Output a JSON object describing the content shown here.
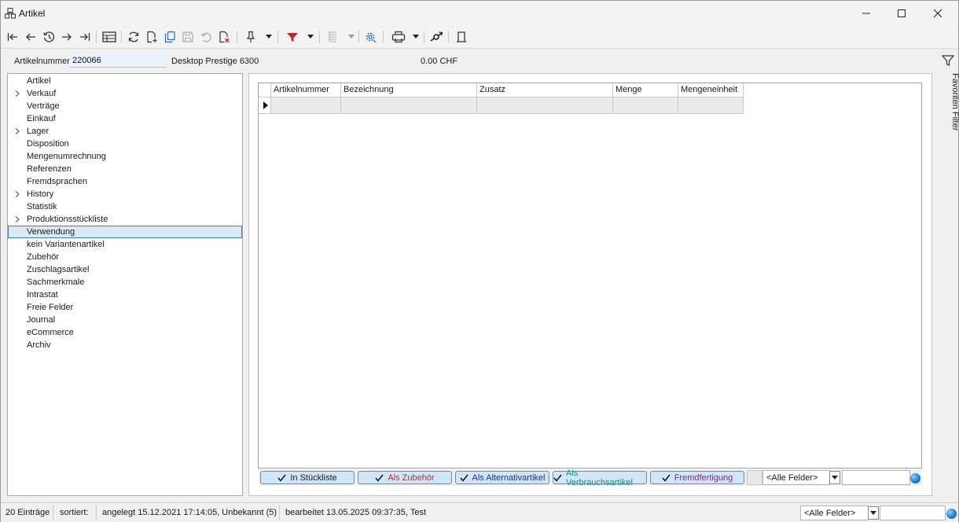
{
  "window": {
    "title": "Artikel"
  },
  "header": {
    "article_number_label": "Artikelnummer",
    "article_number_value": "220066",
    "article_name": "Desktop Prestige 6300",
    "price": "0.00",
    "currency": "CHF"
  },
  "tree": {
    "items": [
      {
        "label": "Artikel",
        "expandable": false
      },
      {
        "label": "Verkauf",
        "expandable": true
      },
      {
        "label": "Verträge",
        "expandable": false
      },
      {
        "label": "Einkauf",
        "expandable": false
      },
      {
        "label": "Lager",
        "expandable": true
      },
      {
        "label": "Disposition",
        "expandable": false
      },
      {
        "label": "Mengenumrechnung",
        "expandable": false
      },
      {
        "label": "Referenzen",
        "expandable": false
      },
      {
        "label": "Fremdsprachen",
        "expandable": false
      },
      {
        "label": "History",
        "expandable": true
      },
      {
        "label": "Statistik",
        "expandable": false
      },
      {
        "label": "Produktionsstückliste",
        "expandable": true
      },
      {
        "label": "Verwendung",
        "expandable": false,
        "selected": true
      },
      {
        "label": "kein Variantenartikel",
        "expandable": false
      },
      {
        "label": "Zubehör",
        "expandable": false
      },
      {
        "label": "Zuschlagsartikel",
        "expandable": false
      },
      {
        "label": "Sachmerkmale",
        "expandable": false
      },
      {
        "label": "Intrastat",
        "expandable": false
      },
      {
        "label": "Freie Felder",
        "expandable": false
      },
      {
        "label": "Journal",
        "expandable": false
      },
      {
        "label": "eCommerce",
        "expandable": false
      },
      {
        "label": "Archiv",
        "expandable": false
      }
    ]
  },
  "grid": {
    "columns": [
      "Artikelnummer",
      "Bezeichnung",
      "Zusatz",
      "Menge",
      "Mengeneinheit"
    ]
  },
  "filters": {
    "toggles": [
      {
        "label": "In Stückliste",
        "color": "#1a1a1a"
      },
      {
        "label": "Als Zubehör",
        "color": "#c0262d"
      },
      {
        "label": "Als Alternativartikel",
        "color": "#1b2f8f"
      },
      {
        "label": "Als Verbrauchsartikel",
        "color": "#1a8f84"
      },
      {
        "label": "Fremdfertigung",
        "color": "#8a1f8c"
      }
    ],
    "field_select": "<Alle Felder>"
  },
  "side": {
    "favorites_label": "Favoriten Filter"
  },
  "status": {
    "count": "20 Einträge",
    "sorted_label": "sortiert:",
    "created": "angelegt 15.12.2021 17:14:05, Unbekannt (5)",
    "edited": "bearbeitet 13.05.2025 09:37:35, Test",
    "field_select": "<Alle Felder>"
  },
  "icons": {
    "toolbar": [
      "first-icon",
      "previous-icon",
      "history-icon",
      "next-icon",
      "last-icon",
      "table-view-icon",
      "refresh-icon",
      "new-document-icon",
      "copy-icon",
      "save-icon",
      "undo-icon",
      "delete-icon",
      "pin-icon",
      "filter-icon",
      "tree-filter-icon",
      "settings-icon",
      "print-icon",
      "link-icon",
      "exit-icon"
    ]
  }
}
